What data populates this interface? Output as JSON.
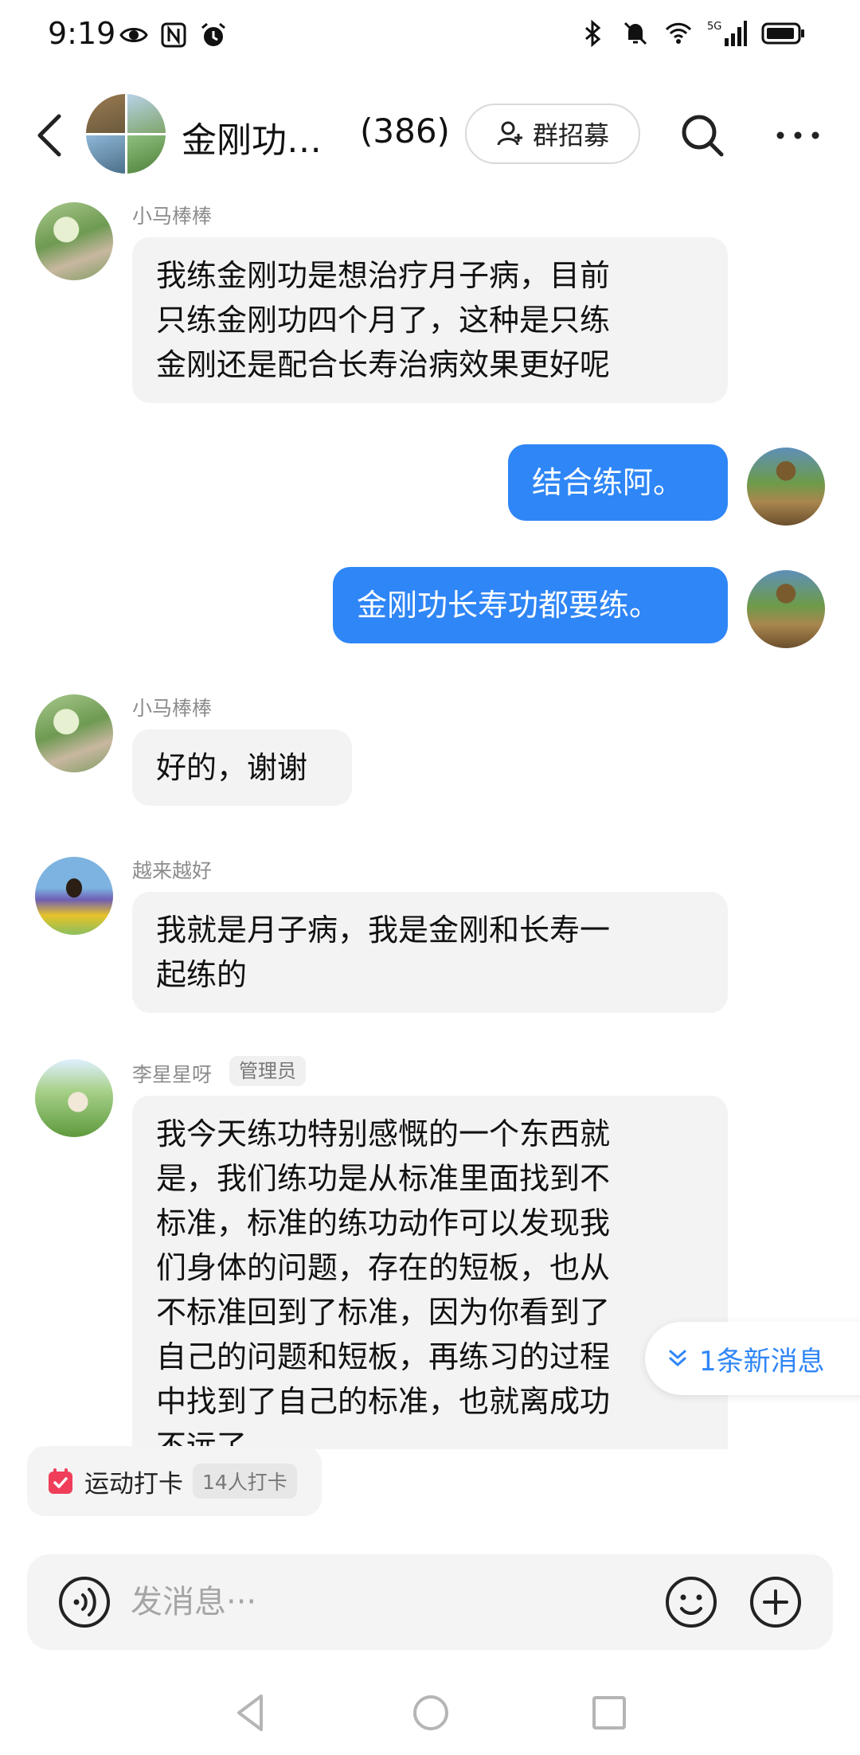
{
  "status_bar": {
    "time": "9:19",
    "left_icons": [
      "eye-icon",
      "nfc-icon",
      "alarm-icon"
    ],
    "right_icons": [
      "bluetooth-icon",
      "mute-icon",
      "wifi-icon",
      "5g-signal-icon",
      "battery-icon"
    ],
    "network_label": "5G"
  },
  "header": {
    "title": "金刚功…",
    "member_count": "(386)",
    "recruit_label": "群招募"
  },
  "messages": [
    {
      "direction": "in",
      "sender": "小马棒棒",
      "avatar": "garden-path-avatar",
      "lines": [
        "我练金刚功是想治疗月子病，目前",
        "只练金刚功四个月了，这种是只练",
        "金刚还是配合长寿治病效果更好呢"
      ]
    },
    {
      "direction": "out",
      "avatar": "tower-avatar",
      "text": "结合练阿。"
    },
    {
      "direction": "out",
      "avatar": "tower-avatar",
      "text": "金刚功长寿功都要练。"
    },
    {
      "direction": "in",
      "sender": "小马棒棒",
      "avatar": "garden-path-avatar",
      "lines": [
        "好的，谢谢"
      ]
    },
    {
      "direction": "in",
      "sender": "越来越好",
      "avatar": "girl-avatar",
      "lines": [
        "我就是月子病，我是金刚和长寿一",
        "起练的"
      ]
    },
    {
      "direction": "in",
      "sender": "李星星呀",
      "badge": "管理员",
      "avatar": "field-avatar",
      "lines": [
        "我今天练功特别感慨的一个东西就",
        "是，我们练功是从标准里面找到不",
        "标准，标准的练功动作可以发现我",
        "们身体的问题，存在的短板，也从",
        "不标准回到了标准，因为你看到了",
        "自己的问题和短板，再练习的过程",
        "中找到了自己的标准，也就离成功",
        "不远了。"
      ]
    }
  ],
  "new_message_label": "1条新消息",
  "checkin": {
    "label": "运动打卡",
    "count": "14人打卡"
  },
  "input": {
    "placeholder": "发消息···"
  },
  "colors": {
    "accent": "#2f86f6",
    "bubble_in": "#f3f3f3",
    "checkin_icon": "#f03e5a"
  }
}
